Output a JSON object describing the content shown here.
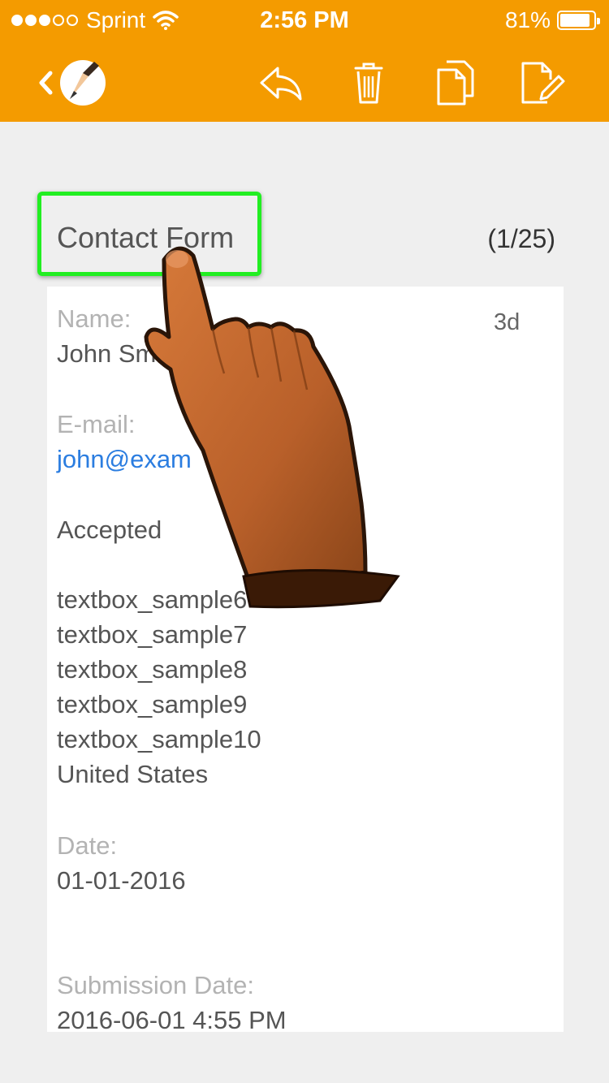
{
  "status_bar": {
    "carrier": "Sprint",
    "time": "2:56 PM",
    "battery": "81%",
    "battery_level": 0.81
  },
  "nav": {
    "back_icon": "chevron-left-icon",
    "logo_icon": "pencil-logo-icon",
    "actions": [
      {
        "name": "reply-icon"
      },
      {
        "name": "trash-icon"
      },
      {
        "name": "copy-icon"
      },
      {
        "name": "edit-icon"
      }
    ]
  },
  "form": {
    "title": "Contact Form",
    "counter": "(1/25)"
  },
  "submission": {
    "age": "3d",
    "name_label": "Name:",
    "name_value": "John Sm",
    "email_label": "E-mail:",
    "email_value": "john@exam",
    "consent": "Accepted",
    "lines": [
      "textbox_sample6",
      "textbox_sample7",
      "textbox_sample8",
      "textbox_sample9",
      "textbox_sample10",
      "United States"
    ],
    "date_label": "Date:",
    "date_value": "01-01-2016",
    "submission_date_label": "Submission Date:",
    "submission_date_value": "2016-06-01 4:55 PM"
  },
  "colors": {
    "header": "#f49b00",
    "highlight": "#22ee22",
    "link": "#2b7de0",
    "background": "#efefef"
  },
  "overlay": {
    "hand_icon": "pointing-hand-icon"
  }
}
